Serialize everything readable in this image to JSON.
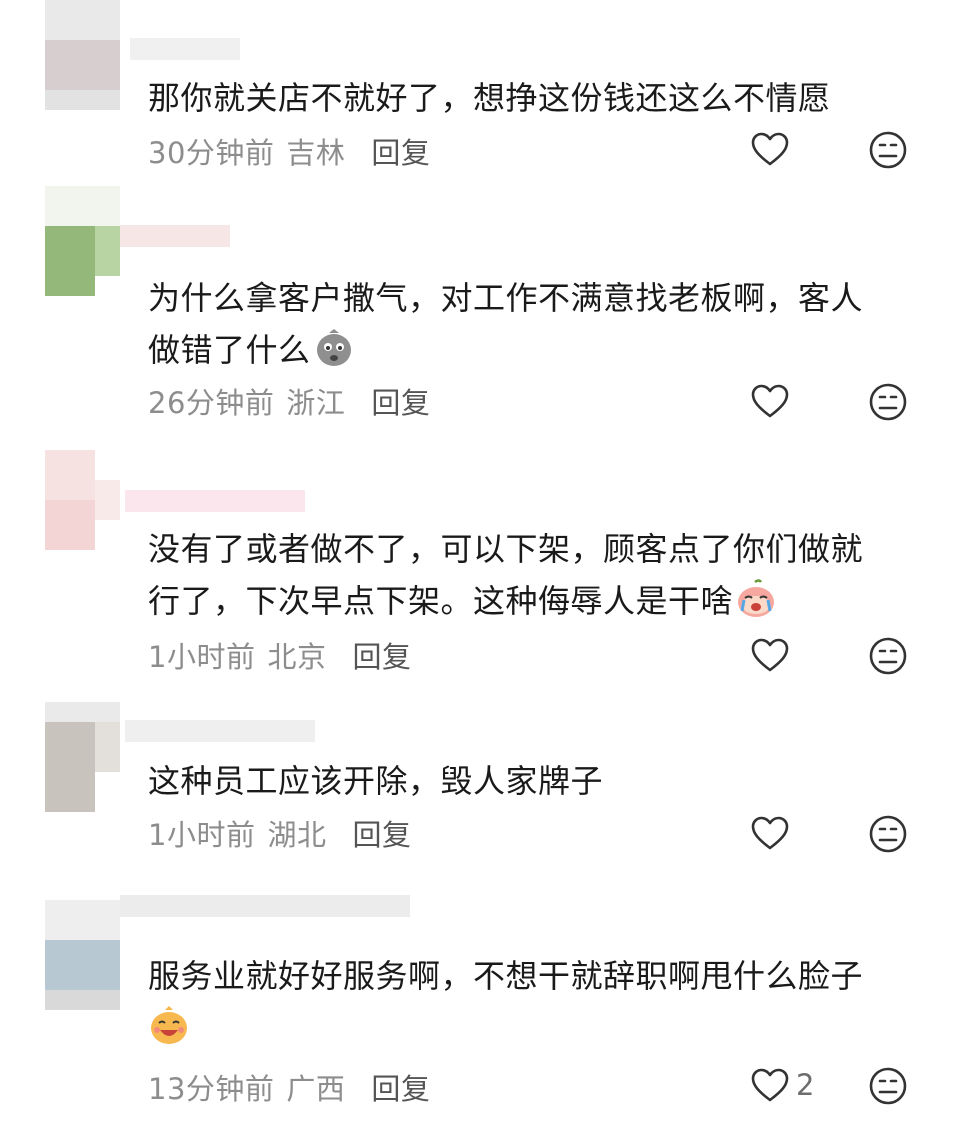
{
  "comments": [
    {
      "text": "那你就关店不就好了，想挣这份钱还这么不情愿",
      "time": "30分钟前",
      "location": "吉林",
      "reply": "回复",
      "like_icon": "heart-outline-icon",
      "dislike_icon": "neutral-face-icon"
    },
    {
      "text_line1": "为什么拿客户撒气，对工作不满意找老板啊，客人",
      "text_line2": "做错了什么",
      "emoji": "sweating-face-emoji",
      "time": "26分钟前",
      "location": "浙江",
      "reply": "回复",
      "like_icon": "heart-outline-icon",
      "dislike_icon": "neutral-face-icon"
    },
    {
      "text_line1": "没有了或者做不了，可以下架，顾客点了你们做就",
      "text_line2": "行了，下次早点下架。这种侮辱人是干啥",
      "emoji": "crying-peach-emoji",
      "time": "1小时前",
      "location": "北京",
      "reply": "回复",
      "like_icon": "heart-outline-icon",
      "dislike_icon": "neutral-face-icon"
    },
    {
      "text": "这种员工应该开除，毁人家牌子",
      "time": "1小时前",
      "location": "湖北",
      "reply": "回复",
      "like_icon": "heart-outline-icon",
      "dislike_icon": "neutral-face-icon"
    },
    {
      "text_line1": "服务业就好好服务啊，不想干就辞职啊甩什么脸子",
      "emoji": "grinning-face-emoji",
      "time": "13分钟前",
      "location": "广西",
      "reply": "回复",
      "like_count": "2",
      "like_icon": "heart-outline-icon",
      "dislike_icon": "neutral-face-icon"
    }
  ],
  "colors": {
    "text": "#1a1a1a",
    "meta": "#8d8d8d",
    "icon": "#333333"
  }
}
